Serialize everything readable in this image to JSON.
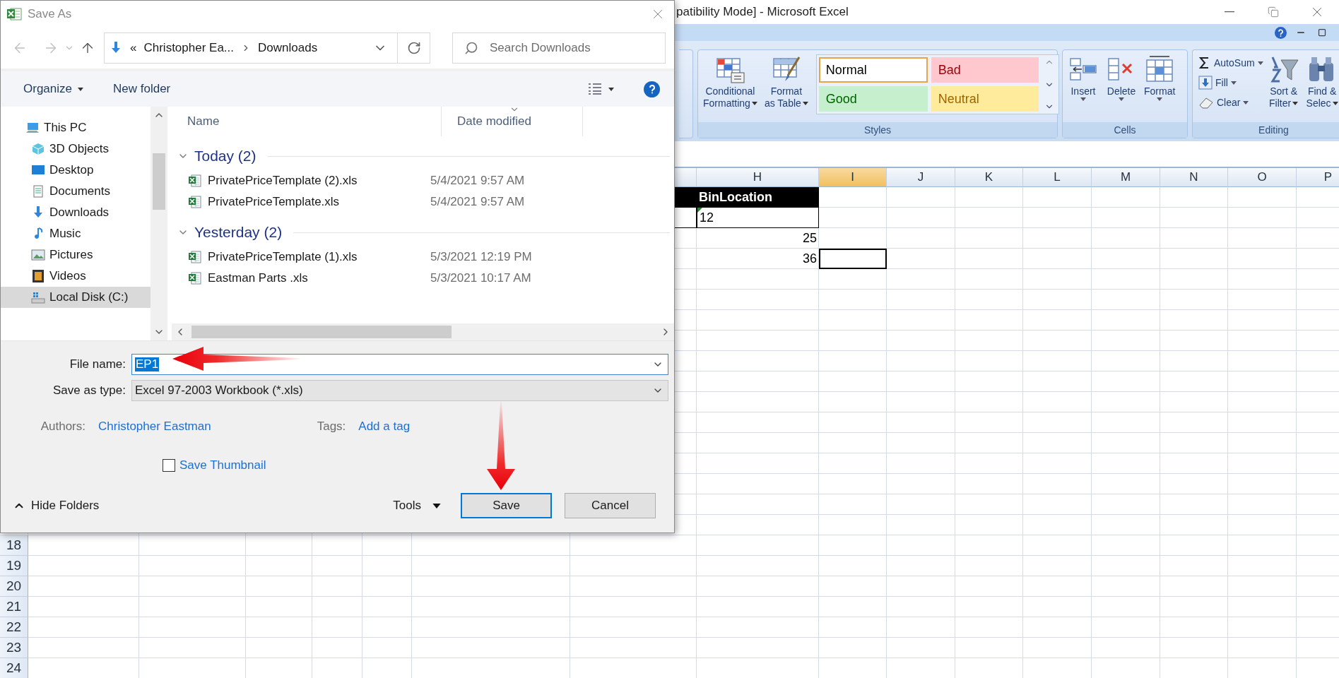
{
  "excel": {
    "title": "patibility Mode] - Microsoft Excel",
    "ribbon": {
      "styles_group": {
        "label": "Styles",
        "buttons": [
          {
            "line1": "Conditional",
            "line2": "Formatting",
            "kind": "conditional"
          },
          {
            "line1": "Format",
            "line2": "as Table",
            "kind": "table"
          }
        ],
        "cell_styles": [
          {
            "label": "Normal",
            "kind": "normal",
            "selected": true
          },
          {
            "label": "Bad",
            "kind": "bad",
            "selected": false
          },
          {
            "label": "Good",
            "kind": "good",
            "selected": false
          },
          {
            "label": "Neutral",
            "kind": "neutral",
            "selected": false
          }
        ]
      },
      "cells_group": {
        "label": "Cells",
        "buttons": [
          {
            "label": "Insert",
            "kind": "insert"
          },
          {
            "label": "Delete",
            "kind": "delete"
          },
          {
            "label": "Format",
            "kind": "format"
          }
        ]
      },
      "editing_group": {
        "label": "Editing",
        "commands": [
          {
            "label": "AutoSum",
            "kind": "autosum"
          },
          {
            "label": "Fill",
            "kind": "fill"
          },
          {
            "label": "Clear",
            "kind": "clear"
          }
        ],
        "buttons": [
          {
            "line1": "Sort &",
            "line2": "Filter",
            "kind": "sort"
          },
          {
            "line1": "Find &",
            "line2": "Selec",
            "kind": "find"
          }
        ]
      }
    },
    "sheet": {
      "columns": [
        {
          "selected": false,
          "cells": [
            {
              "kind": "header"
            },
            {
              "kind": "boxed"
            }
          ]
        },
        {
          "label": "H",
          "selected": false,
          "cells": [
            {
              "kind": "header",
              "text": "BinLocation"
            },
            {
              "kind": "flagged",
              "text": "12"
            },
            {
              "kind": "number",
              "text": "25"
            },
            {
              "kind": "number",
              "text": "36"
            }
          ]
        },
        {
          "label": "I",
          "selected": true,
          "cells": [
            {
              "kind": "blank",
              "selected": false
            },
            {
              "kind": "blank",
              "selected": false
            },
            {
              "kind": "blank",
              "selected": false
            },
            {
              "kind": "blank",
              "selected": true
            }
          ]
        },
        {
          "label": "J",
          "selected": false
        },
        {
          "label": "K",
          "selected": false
        },
        {
          "label": "L",
          "selected": false
        },
        {
          "label": "M",
          "selected": false
        },
        {
          "label": "N",
          "selected": false
        },
        {
          "label": "O",
          "selected": false
        },
        {
          "label": "P",
          "selected": false
        }
      ],
      "row_numbers": [
        "18",
        "19",
        "20",
        "21",
        "22",
        "23",
        "24"
      ]
    }
  },
  "dialog": {
    "title": "Save As",
    "address": {
      "overflow": "«",
      "crumbs": [
        "Christopher Ea...",
        "Downloads"
      ]
    },
    "search": {
      "placeholder": "Search Downloads"
    },
    "toolbar": {
      "organize": "Organize",
      "new_folder": "New folder"
    },
    "nav_tree": [
      {
        "label": "This PC",
        "kind": "pc",
        "selected": false,
        "children": [
          {
            "label": "3D Objects",
            "kind": "cube",
            "selected": false
          },
          {
            "label": "Desktop",
            "kind": "desktop",
            "selected": false
          },
          {
            "label": "Documents",
            "kind": "documents",
            "selected": false
          },
          {
            "label": "Downloads",
            "kind": "downloads",
            "selected": false
          },
          {
            "label": "Music",
            "kind": "music",
            "selected": false
          },
          {
            "label": "Pictures",
            "kind": "pictures",
            "selected": false
          },
          {
            "label": "Videos",
            "kind": "videos",
            "selected": false
          },
          {
            "label": "Local Disk (C:)",
            "kind": "disk",
            "selected": true
          }
        ]
      }
    ],
    "file_columns": [
      "Name",
      "Date modified"
    ],
    "file_groups": [
      {
        "label": "Today (2)",
        "expanded": true,
        "files": [
          {
            "name": "PrivatePriceTemplate (2).xls",
            "date": "5/4/2021 9:57 AM"
          },
          {
            "name": "PrivatePriceTemplate.xls",
            "date": "5/4/2021 9:57 AM"
          }
        ]
      },
      {
        "label": "Yesterday (2)",
        "expanded": true,
        "files": [
          {
            "name": "PrivatePriceTemplate (1).xls",
            "date": "5/3/2021 12:19 PM"
          },
          {
            "name": "Eastman Parts .xls",
            "date": "5/3/2021 10:17 AM"
          }
        ]
      }
    ],
    "file_name": {
      "label": "File name:",
      "value": "EP1"
    },
    "save_as_type": {
      "label": "Save as type:",
      "value": "Excel 97-2003 Workbook (*.xls)"
    },
    "authors": {
      "label": "Authors:",
      "value": "Christopher Eastman"
    },
    "tags": {
      "label": "Tags:",
      "value": "Add a tag"
    },
    "save_thumbnail": {
      "label": "Save Thumbnail",
      "checked": false
    },
    "hide_folders": "Hide Folders",
    "tools": "Tools",
    "buttons": [
      {
        "label": "Save",
        "kind": "primary"
      },
      {
        "label": "Cancel",
        "kind": "secondary"
      }
    ]
  }
}
